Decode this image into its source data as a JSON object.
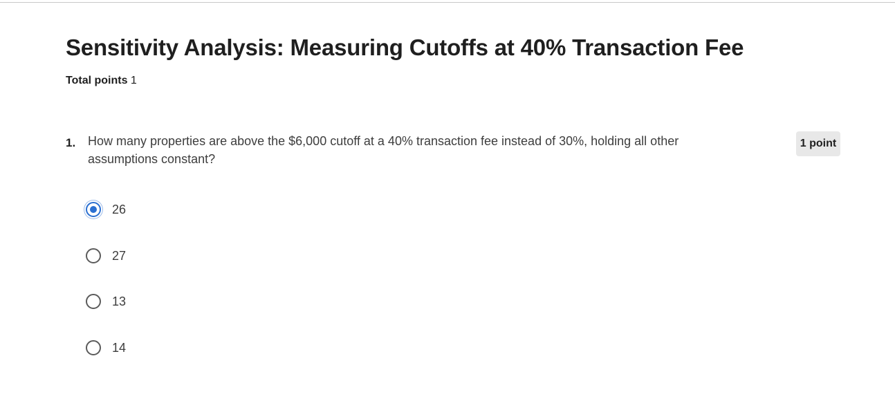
{
  "assignment": {
    "title": "Sensitivity Analysis: Measuring Cutoffs at 40% Transaction Fee",
    "total_points_label": "Total points",
    "total_points_value": "1"
  },
  "question": {
    "number": "1.",
    "text": "How many properties are above the $6,000 cutoff at a 40% transaction fee instead of 30%, holding all other assumptions constant?",
    "points_badge": "1 point",
    "options": [
      {
        "label": "26",
        "selected": true
      },
      {
        "label": "27",
        "selected": false
      },
      {
        "label": "13",
        "selected": false
      },
      {
        "label": "14",
        "selected": false
      }
    ]
  },
  "colors": {
    "accent": "#2a6fd1",
    "badge_bg": "#e8e8e8"
  }
}
